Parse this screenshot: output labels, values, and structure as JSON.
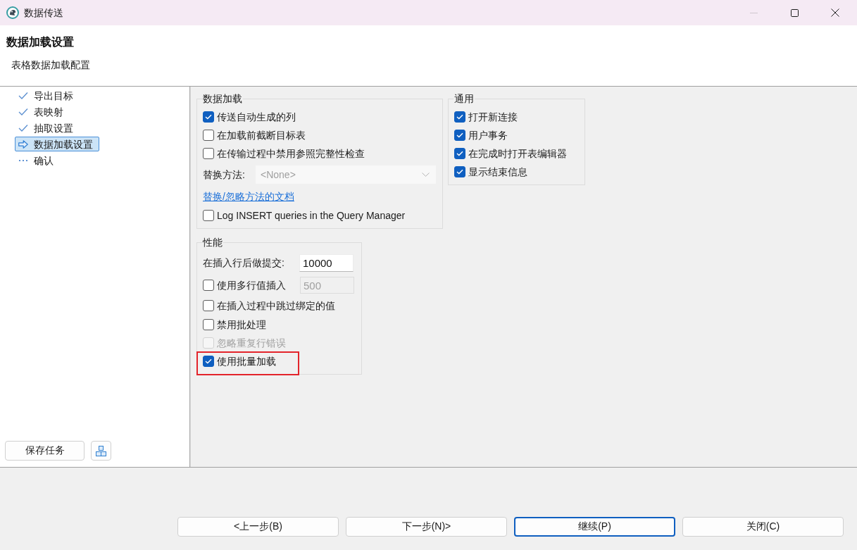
{
  "window": {
    "title": "数据传送",
    "minimize_disabled": true
  },
  "header": {
    "title": "数据加载设置",
    "subtitle": "表格数据加载配置"
  },
  "steps": [
    {
      "label": "导出目标",
      "kind": "done",
      "selected": false
    },
    {
      "label": "表映射",
      "kind": "done",
      "selected": false
    },
    {
      "label": "抽取设置",
      "kind": "done",
      "selected": false
    },
    {
      "label": "数据加载设置",
      "kind": "current",
      "selected": true
    },
    {
      "label": "确认",
      "kind": "pending",
      "selected": false
    }
  ],
  "save_task_button": {
    "label": "保存任务"
  },
  "data_load": {
    "title": "数据加载",
    "items": [
      {
        "kind": "checkbox",
        "label": "传送自动生成的列",
        "checked": true,
        "disabled": false
      },
      {
        "kind": "checkbox",
        "label": "在加载前截断目标表",
        "checked": false,
        "disabled": false
      },
      {
        "kind": "checkbox",
        "label": "在传输过程中禁用参照完整性检查",
        "checked": false,
        "disabled": false
      },
      {
        "kind": "select",
        "label": "替换方法:",
        "value": "<None>",
        "disabled": true
      },
      {
        "kind": "link",
        "label": "替换/忽略方法的文档"
      },
      {
        "kind": "checkbox",
        "label": "Log INSERT queries in the Query Manager",
        "checked": false,
        "disabled": false
      }
    ]
  },
  "general": {
    "title": "通用",
    "items": [
      {
        "label": "打开新连接",
        "checked": true
      },
      {
        "label": "用户事务",
        "checked": true
      },
      {
        "label": "在完成时打开表编辑器",
        "checked": true
      },
      {
        "label": "显示结束信息",
        "checked": true
      }
    ]
  },
  "performance": {
    "title": "性能",
    "items": [
      {
        "kind": "number",
        "label": "在插入行后做提交:",
        "value": "10000",
        "field_disabled": false,
        "highlighted": false
      },
      {
        "kind": "checkbox_number",
        "label": "使用多行值插入",
        "checked": false,
        "value": "500",
        "field_disabled": true,
        "highlighted": false
      },
      {
        "kind": "checkbox",
        "label": "在插入过程中跳过绑定的值",
        "checked": false,
        "disabled": false,
        "highlighted": false
      },
      {
        "kind": "checkbox",
        "label": "禁用批处理",
        "checked": false,
        "disabled": false,
        "highlighted": false
      },
      {
        "kind": "checkbox",
        "label": "忽略重复行错误",
        "checked": false,
        "disabled": true,
        "highlighted": false
      },
      {
        "kind": "checkbox",
        "label": "使用批量加载",
        "checked": true,
        "disabled": false,
        "highlighted": true
      }
    ]
  },
  "footer": {
    "buttons": [
      {
        "label": "<上一步(B)",
        "focused": false
      },
      {
        "label": "下一步(N)>",
        "focused": false
      },
      {
        "label": "继续(P)",
        "focused": true
      },
      {
        "label": "关闭(C)",
        "focused": false
      }
    ]
  }
}
